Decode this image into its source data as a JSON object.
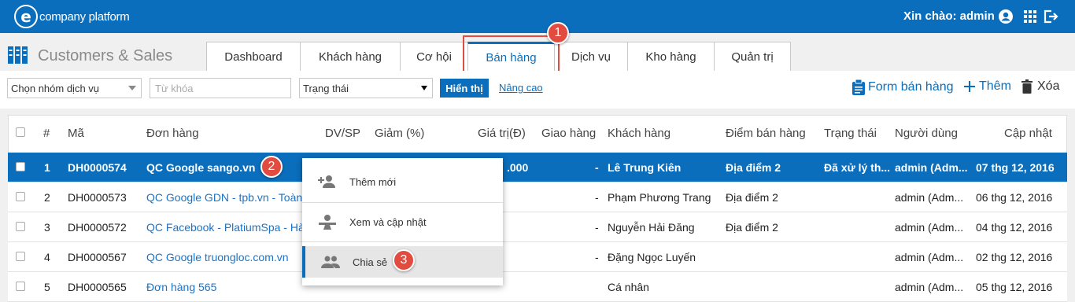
{
  "app": {
    "logo_text": "company platform",
    "logo_letter": "e",
    "greeting": "Xin chào: admin",
    "title": "Customers & Sales"
  },
  "tabs": [
    {
      "label": "Dashboard"
    },
    {
      "label": "Khách hàng"
    },
    {
      "label": "Cơ hội"
    },
    {
      "label": "Bán hàng",
      "active": true
    },
    {
      "label": "Dịch vụ"
    },
    {
      "label": "Kho hàng"
    },
    {
      "label": "Quản trị"
    }
  ],
  "filters": {
    "group_select": "Chọn nhóm dịch vụ",
    "keyword_placeholder": "Từ khóa",
    "status_select": "Trạng thái",
    "show_button": "Hiển thị",
    "advanced_link": "Nâng cao"
  },
  "actions": {
    "form": "Form bán hàng",
    "add": "Thêm",
    "delete": "Xóa"
  },
  "table": {
    "headers": [
      "#",
      "Mã",
      "Đơn hàng",
      "DV/SP",
      "Giảm (%)",
      "Giá trị(Đ)",
      "Giao hàng",
      "Khách hàng",
      "Điểm bán hàng",
      "Trạng thái",
      "Người dùng",
      "Cập nhật"
    ],
    "rows": [
      {
        "num": "1",
        "code": "DH0000574",
        "order": "QC Google sango.vn",
        "value": ".000",
        "delivery": "-",
        "customer": "Lê Trung Kiên",
        "point": "Địa điểm 2",
        "status": "Đã xử lý th...",
        "user": "admin (Adm...",
        "updated": "07 thg 12, 2016"
      },
      {
        "num": "2",
        "code": "DH0000573",
        "order": "QC Google GDN - tpb.vn - Toàn ...",
        "value": "",
        "delivery": "-",
        "customer": "Phạm Phương Trang",
        "point": "Địa điểm 2",
        "status": "",
        "user": "admin (Adm...",
        "updated": "06 thg 12, 2016"
      },
      {
        "num": "3",
        "code": "DH0000572",
        "order": "QC Facebook - PlatiumSpa - Hà ...",
        "value": "",
        "delivery": "-",
        "customer": "Nguyễn Hải Đăng",
        "point": "Địa điểm 2",
        "status": "",
        "user": "admin (Adm...",
        "updated": "04 thg 12, 2016"
      },
      {
        "num": "4",
        "code": "DH0000567",
        "order": "QC Google truongloc.com.vn",
        "value": "",
        "delivery": "-",
        "customer": "Đặng Ngọc Luyến",
        "point": "",
        "status": "",
        "user": "admin (Adm...",
        "updated": "02 thg 12, 2016"
      },
      {
        "num": "5",
        "code": "DH0000565",
        "order": "Đơn hàng 565",
        "value": "",
        "delivery": "",
        "customer": "Cá nhân",
        "point": "",
        "status": "",
        "user": "admin (Adm...",
        "updated": "05 thg 12, 2016"
      }
    ]
  },
  "context_menu": {
    "items": [
      "Thêm mới",
      "Xem và cập nhật",
      "Chia sẻ"
    ],
    "hovered": "Chia sẻ"
  },
  "callouts": [
    "1",
    "2",
    "3"
  ],
  "colors": {
    "primary": "#0a6ebd",
    "callout": "#e24b3f"
  }
}
